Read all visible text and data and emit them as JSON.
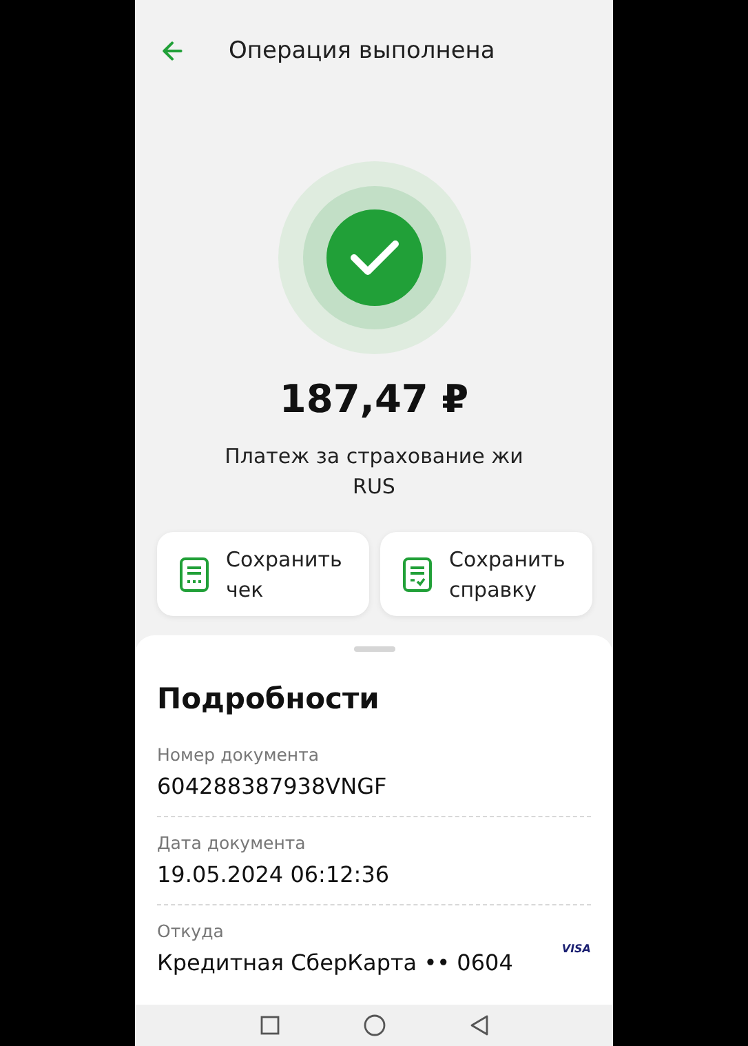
{
  "header": {
    "title": "Операция выполнена"
  },
  "status": {
    "kind": "success"
  },
  "amount": "187,47 ₽",
  "description": [
    "Платеж за страхование жи",
    "RUS"
  ],
  "actions": [
    {
      "label": "Сохранить чек",
      "kind": "receipt"
    },
    {
      "label": "Сохранить справку",
      "kind": "certificate"
    }
  ],
  "details": {
    "title": "Подробности",
    "fields": [
      {
        "label": "Номер документа",
        "value": "604288387938VNGF"
      },
      {
        "label": "Дата документа",
        "value": "19.05.2024 06:12:36"
      },
      {
        "label": "Откуда",
        "value": "Кредитная СберКарта •• 0604",
        "badge": "VISA"
      }
    ]
  }
}
